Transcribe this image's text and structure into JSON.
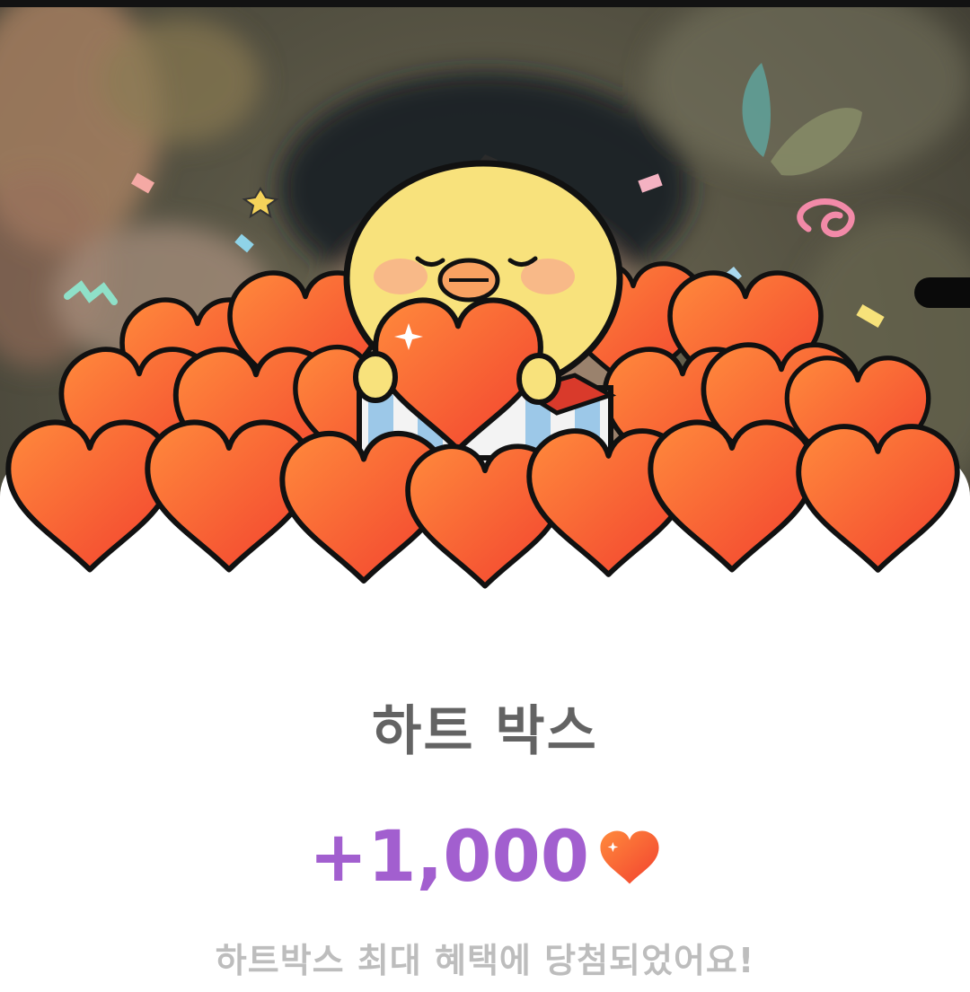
{
  "popup": {
    "title": "하트 박스",
    "reward_amount": "+1,000",
    "reward_icon": "heart-icon",
    "description": "하트박스 최대 혜택에 당첨되었어요!"
  },
  "colors": {
    "amount": "#a25fcf",
    "heart_top": "#ff7a38",
    "heart_bottom": "#f0402e",
    "title": "#636363",
    "description": "#bdbdbd"
  }
}
